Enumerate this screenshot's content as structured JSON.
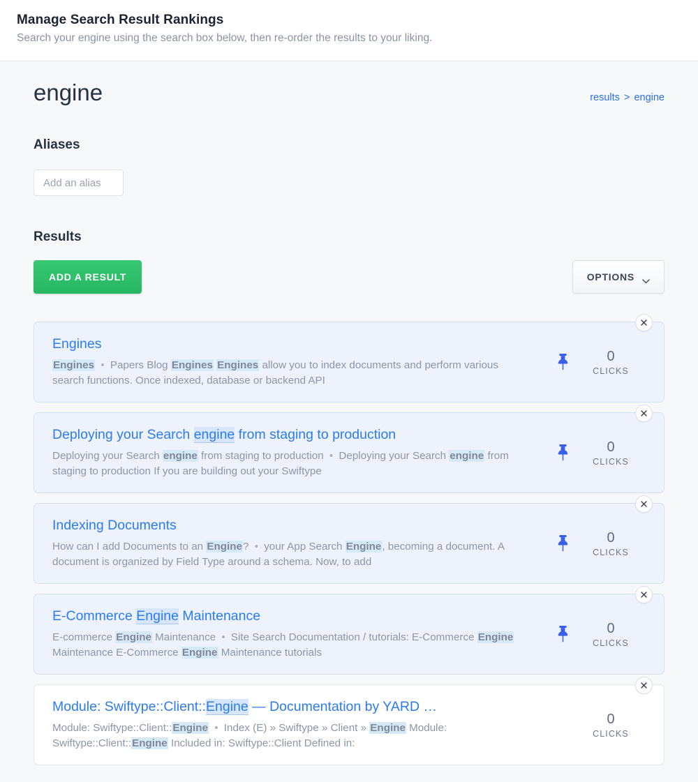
{
  "header": {
    "title": "Manage Search Result Rankings",
    "subtitle": "Search your engine using the search box below, then re-order the results to your liking."
  },
  "query": {
    "term": "engine",
    "breadcrumb_root": "results",
    "breadcrumb_sep": ">",
    "breadcrumb_leaf": "engine"
  },
  "aliases": {
    "heading": "Aliases",
    "input_placeholder": "Add an alias",
    "input_value": ""
  },
  "results_section": {
    "heading": "Results",
    "add_button_label": "ADD A RESULT",
    "options_button_label": "OPTIONS",
    "options_icon": "chevron-down-icon",
    "close_icon": "close-icon",
    "pin_icon": "pushpin-icon",
    "clicks_label": "CLICKS"
  },
  "colors": {
    "page_background": "#f7f8fa",
    "header_background": "#ffffff",
    "accent_link": "#2b7cf0",
    "breadcrumb_link": "#2b6fee",
    "add_button": "#2ec06a",
    "card_highlight_background": "#edf2fd",
    "card_highlight_border": "#d6e0f5",
    "card_plain_background": "#ffffff",
    "pin_color": "#3b5ee8",
    "term_highlight": "#d6e9f7",
    "title_highlight": "#d8e6fb"
  },
  "results": [
    {
      "title_parts": [
        {
          "text": "Engines",
          "highlight": false
        }
      ],
      "description_parts": [
        {
          "text": "Engines",
          "highlight": true
        },
        {
          "text": " ",
          "highlight": false
        },
        {
          "text": "•",
          "dot": true
        },
        {
          "text": " Papers Blog ",
          "highlight": false
        },
        {
          "text": "Engines",
          "highlight": true
        },
        {
          "text": " ",
          "highlight": false
        },
        {
          "text": "Engines",
          "highlight": true
        },
        {
          "text": " allow you to index documents and perform various search functions. Once indexed, database or backend API",
          "highlight": false
        }
      ],
      "clicks": "0",
      "pinned": true
    },
    {
      "title_parts": [
        {
          "text": "Deploying your Search ",
          "highlight": false
        },
        {
          "text": "engine",
          "highlight": true
        },
        {
          "text": " from staging to production",
          "highlight": false
        }
      ],
      "description_parts": [
        {
          "text": "Deploying your Search ",
          "highlight": false
        },
        {
          "text": "engine",
          "highlight": true
        },
        {
          "text": " from staging to production ",
          "highlight": false
        },
        {
          "text": "•",
          "dot": true
        },
        {
          "text": " Deploying your Search ",
          "highlight": false
        },
        {
          "text": "engine",
          "highlight": true
        },
        {
          "text": " from staging to production If you are building out your Swiftype",
          "highlight": false
        }
      ],
      "clicks": "0",
      "pinned": true
    },
    {
      "title_parts": [
        {
          "text": "Indexing Documents",
          "highlight": false
        }
      ],
      "description_parts": [
        {
          "text": "How can I add Documents to an ",
          "highlight": false
        },
        {
          "text": "Engine",
          "highlight": true
        },
        {
          "text": "? ",
          "highlight": false
        },
        {
          "text": "•",
          "dot": true
        },
        {
          "text": " your App Search ",
          "highlight": false
        },
        {
          "text": "Engine",
          "highlight": true
        },
        {
          "text": ", becoming a document. A document is organized by Field Type around a schema. Now, to add",
          "highlight": false
        }
      ],
      "clicks": "0",
      "pinned": true
    },
    {
      "title_parts": [
        {
          "text": "E-Commerce ",
          "highlight": false
        },
        {
          "text": "Engine",
          "highlight": true
        },
        {
          "text": " Maintenance",
          "highlight": false
        }
      ],
      "description_parts": [
        {
          "text": "E-commerce ",
          "highlight": false
        },
        {
          "text": "Engine",
          "highlight": true
        },
        {
          "text": " Maintenance ",
          "highlight": false
        },
        {
          "text": "•",
          "dot": true
        },
        {
          "text": " Site Search Documentation / tutorials: E-Commerce ",
          "highlight": false
        },
        {
          "text": "Engine",
          "highlight": true
        },
        {
          "text": " Maintenance E-Commerce ",
          "highlight": false
        },
        {
          "text": "Engine",
          "highlight": true
        },
        {
          "text": " Maintenance tutorials",
          "highlight": false
        }
      ],
      "clicks": "0",
      "pinned": true
    },
    {
      "title_parts": [
        {
          "text": "Module: Swiftype::Client::",
          "highlight": false
        },
        {
          "text": "Engine",
          "highlight": true
        },
        {
          "text": " — Documentation by YARD …",
          "highlight": false
        }
      ],
      "description_parts": [
        {
          "text": "Module: Swiftype::Client::",
          "highlight": false
        },
        {
          "text": "Engine",
          "highlight": true
        },
        {
          "text": " ",
          "highlight": false
        },
        {
          "text": "•",
          "dot": true
        },
        {
          "text": " Index (E) » Swiftype » Client » ",
          "highlight": false
        },
        {
          "text": "Engine",
          "highlight": true
        },
        {
          "text": " Module: Swiftype::Client::",
          "highlight": false
        },
        {
          "text": "Engine",
          "highlight": true
        },
        {
          "text": " Included in: Swiftype::Client Defined in:",
          "highlight": false
        }
      ],
      "clicks": "0",
      "pinned": false
    }
  ]
}
